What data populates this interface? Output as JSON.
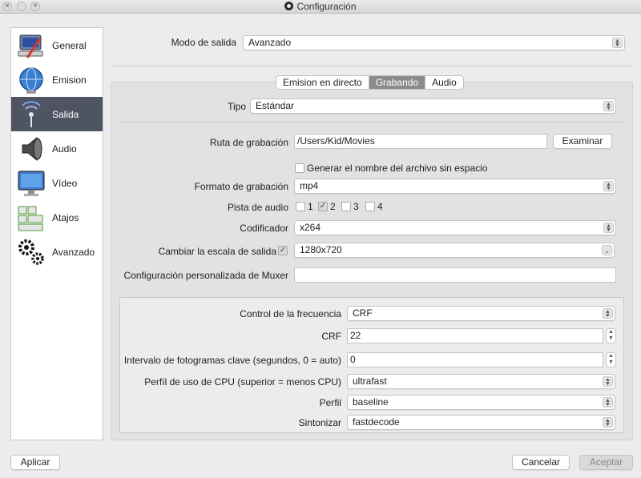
{
  "window": {
    "title": "Configuración"
  },
  "sidebar": {
    "items": [
      {
        "label": "General",
        "icon": "computer-icon"
      },
      {
        "label": "Emision",
        "icon": "globe-icon"
      },
      {
        "label": "Salida",
        "icon": "broadcast-icon",
        "active": true
      },
      {
        "label": "Audio",
        "icon": "speaker-icon"
      },
      {
        "label": "Vídeo",
        "icon": "monitor-icon"
      },
      {
        "label": "Atajos",
        "icon": "keyboard-icon"
      },
      {
        "label": "Avanzado",
        "icon": "gears-icon"
      }
    ]
  },
  "output_mode": {
    "label": "Modo de salida",
    "value": "Avanzado"
  },
  "tabs": [
    "Emision en directo",
    "Grabando",
    "Audio"
  ],
  "active_tab": "Grabando",
  "recording": {
    "type_label": "Tipo",
    "type_value": "Estándar",
    "path_label": "Ruta de grabación",
    "path_value": "/Users/Kid/Movies",
    "browse_label": "Examinar",
    "nospace_label": "Generar el nombre del archivo sin espacio",
    "format_label": "Formato de grabación",
    "format_value": "mp4",
    "tracks_label": "Pista de audio",
    "tracks": [
      {
        "label": "1",
        "checked": false
      },
      {
        "label": "2",
        "checked": true
      },
      {
        "label": "3",
        "checked": false
      },
      {
        "label": "4",
        "checked": false
      }
    ],
    "encoder_label": "Codificador",
    "encoder_value": "x264",
    "rescale_label": "Cambiar la escala de salida",
    "rescale_value": "1280x720",
    "muxer_label": "Configuración personalizada de Muxer",
    "muxer_value": ""
  },
  "encoder_settings": {
    "rate_control_label": "Control de la frecuencia",
    "rate_control_value": "CRF",
    "crf_label": "CRF",
    "crf_value": "22",
    "keyframe_label": "Intervalo de fotogramas clave (segundos, 0 = auto)",
    "keyframe_value": "0",
    "cpu_label": "Perfíl de uso de CPU (superior = menos CPU)",
    "cpu_value": "ultrafast",
    "profile_label": "Perfil",
    "profile_value": "baseline",
    "tune_label": "Sintonizar",
    "tune_value": "fastdecode"
  },
  "footer": {
    "apply": "Aplicar",
    "cancel": "Cancelar",
    "accept": "Aceptar"
  },
  "colors": {
    "sidebar_active": "#4f5462",
    "tab_active": "#8b8b8b"
  }
}
